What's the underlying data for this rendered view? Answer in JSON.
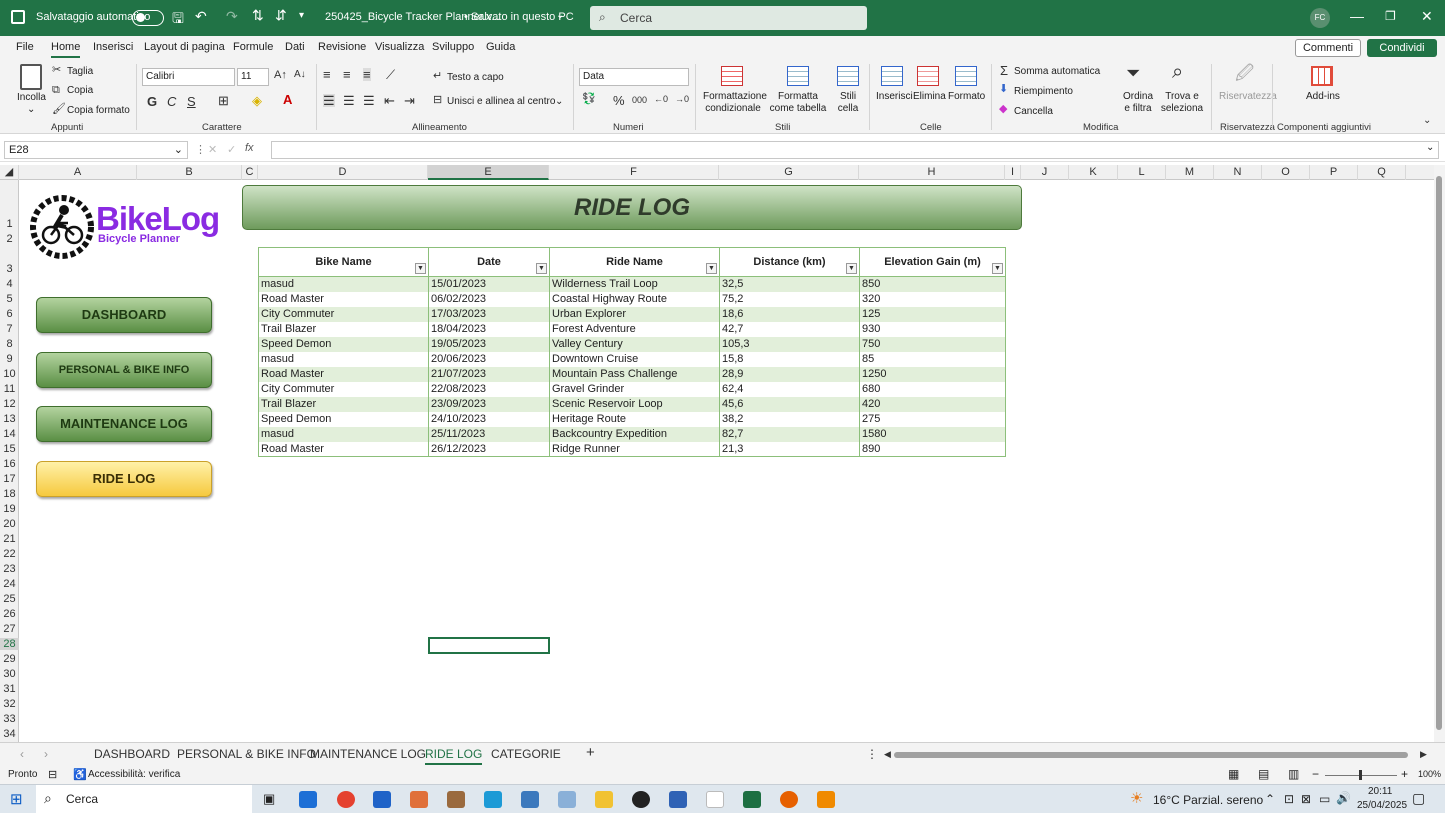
{
  "titlebar": {
    "autosave_label": "Salvataggio automatico",
    "filename": "250425_Bicycle Tracker Planner.x...",
    "saved_status": "• Salvato in questo PC",
    "search_placeholder": "Cerca",
    "user_initials": "FC"
  },
  "menu": {
    "items": [
      "File",
      "Home",
      "Inserisci",
      "Layout di pagina",
      "Formule",
      "Dati",
      "Revisione",
      "Visualizza",
      "Sviluppo",
      "Guida"
    ],
    "active": "Home",
    "comments": "Commenti",
    "share": "Condividi"
  },
  "ribbon": {
    "paste": "Incolla",
    "cut": "Taglia",
    "copy": "Copia",
    "format_painter": "Copia formato",
    "font_name": "Calibri",
    "font_size": "11",
    "bold": "G",
    "italic": "C",
    "underline": "S",
    "wrap_text": "Testo a capo",
    "merge_center": "Unisci e allinea al centro",
    "number_format": "Data",
    "cond_format": "Formattazione condizionale",
    "format_table": "Formatta come tabella",
    "cell_styles": "Stili cella",
    "insert": "Inserisci",
    "delete": "Elimina",
    "format": "Formato",
    "autosum": "Somma automatica",
    "fill": "Riempimento",
    "clear": "Cancella",
    "sort_filter": "Ordina e filtra",
    "find_select": "Trova e seleziona",
    "sensitivity": "Riservatezza",
    "addins": "Add-ins",
    "groups": {
      "clipboard": "Appunti",
      "font": "Carattere",
      "alignment": "Allineamento",
      "number": "Numeri",
      "styles": "Stili",
      "cells": "Celle",
      "editing": "Modifica",
      "privacy": "Riservatezza",
      "addins": "Componenti aggiuntivi"
    }
  },
  "formula_bar": {
    "name_box": "E28",
    "fx": "fx",
    "formula": ""
  },
  "columns": [
    "A",
    "B",
    "C",
    "D",
    "E",
    "F",
    "G",
    "H",
    "I",
    "J",
    "K",
    "L",
    "M",
    "N",
    "O",
    "P",
    "Q"
  ],
  "rows": [
    "1",
    "2",
    "3",
    "4",
    "5",
    "6",
    "7",
    "8",
    "9",
    "10",
    "11",
    "12",
    "13",
    "14",
    "15",
    "16",
    "17",
    "18",
    "19",
    "20",
    "21",
    "22",
    "23",
    "24",
    "25",
    "26",
    "27",
    "28",
    "29",
    "30",
    "31",
    "32",
    "33",
    "34"
  ],
  "logo": {
    "name": "BikeLog",
    "tagline": "Bicycle Planner"
  },
  "sheet": {
    "title": "RIDE LOG",
    "nav_buttons": [
      "DASHBOARD",
      "PERSONAL & BIKE INFO",
      "MAINTENANCE LOG",
      "RIDE LOG"
    ],
    "table": {
      "headers": [
        "Bike Name",
        "Date",
        "Ride Name",
        "Distance (km)",
        "Elevation Gain (m)"
      ],
      "rows": [
        [
          "masud",
          "15/01/2023",
          "Wilderness Trail Loop",
          "32,5",
          "850"
        ],
        [
          "Road Master",
          "06/02/2023",
          "Coastal Highway Route",
          "75,2",
          "320"
        ],
        [
          "City Commuter",
          "17/03/2023",
          "Urban Explorer",
          "18,6",
          "125"
        ],
        [
          "Trail Blazer",
          "18/04/2023",
          "Forest Adventure",
          "42,7",
          "930"
        ],
        [
          "Speed Demon",
          "19/05/2023",
          "Valley Century",
          "105,3",
          "750"
        ],
        [
          "masud",
          "20/06/2023",
          "Downtown Cruise",
          "15,8",
          "85"
        ],
        [
          "Road Master",
          "21/07/2023",
          "Mountain Pass Challenge",
          "28,9",
          "1250"
        ],
        [
          "City Commuter",
          "22/08/2023",
          "Gravel Grinder",
          "62,4",
          "680"
        ],
        [
          "Trail Blazer",
          "23/09/2023",
          "Scenic Reservoir Loop",
          "45,6",
          "420"
        ],
        [
          "Speed Demon",
          "24/10/2023",
          "Heritage Route",
          "38,2",
          "275"
        ],
        [
          "masud",
          "25/11/2023",
          "Backcountry Expedition",
          "82,7",
          "1580"
        ],
        [
          "Road Master",
          "26/12/2023",
          "Ridge Runner",
          "21,3",
          "890"
        ]
      ]
    }
  },
  "sheet_tabs": {
    "tabs": [
      "DASHBOARD",
      "PERSONAL & BIKE INFO",
      "MAINTENANCE LOG",
      "RIDE LOG",
      "CATEGORIE"
    ],
    "active": "RIDE LOG",
    "add": "+"
  },
  "status": {
    "ready": "Pronto",
    "accessibility": "Accessibilità: verifica",
    "zoom": "100%"
  },
  "taskbar": {
    "search": "Cerca",
    "weather": "16°C  Parzial. sereno",
    "time": "20:11",
    "date": "25/04/2025"
  },
  "colors": {
    "excel_green": "#217346",
    "band_green": "#e2efda",
    "nav_yellow": "#f6c93e",
    "logo_purple": "#8a2be2"
  }
}
